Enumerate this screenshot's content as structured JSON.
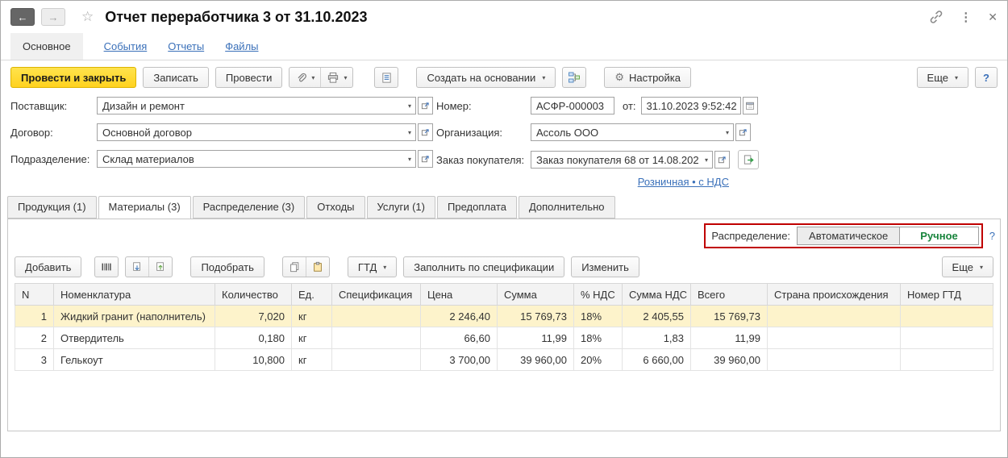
{
  "icons": {
    "back": "←",
    "forward": "→",
    "star": "☆",
    "kebab": "⋮",
    "close": "✕",
    "caret": "▾",
    "gear": "⚙"
  },
  "colors": {
    "accent_yellow": "#ffd21f",
    "link_blue": "#3a70b9",
    "annotation_red": "#c00000",
    "selected_row": "#fdf3cb",
    "manual_green": "#18843c"
  },
  "titlebar": {
    "title": "Отчет переработчика 3 от 31.10.2023"
  },
  "nav": {
    "items": [
      {
        "label": "Основное",
        "active": true
      },
      {
        "label": "События"
      },
      {
        "label": "Отчеты"
      },
      {
        "label": "Файлы"
      }
    ]
  },
  "toolbar": {
    "post_and_close": "Провести и закрыть",
    "save": "Записать",
    "post": "Провести",
    "create_on_base": "Создать на основании",
    "settings": "Настройка",
    "more": "Еще",
    "help": "?"
  },
  "form": {
    "supplier": {
      "label": "Поставщик:",
      "value": "Дизайн и ремонт"
    },
    "contract": {
      "label": "Договор:",
      "value": "Основной договор"
    },
    "department": {
      "label": "Подразделение:",
      "value": "Склад материалов"
    },
    "number": {
      "label": "Номер:",
      "value": "АСФР-000003"
    },
    "date": {
      "label": "от:",
      "value": "31.10.2023 9:52:42"
    },
    "organization": {
      "label": "Организация:",
      "value": "Ассоль ООО"
    },
    "order": {
      "label": "Заказ покупателя:",
      "value": "Заказ покупателя 68 от 14.08.202"
    },
    "price_type_link": "Розничная • с НДС"
  },
  "tabs": {
    "items": [
      {
        "label": "Продукция (1)"
      },
      {
        "label": "Материалы (3)",
        "active": true
      },
      {
        "label": "Распределение (3)"
      },
      {
        "label": "Отходы"
      },
      {
        "label": "Услуги (1)"
      },
      {
        "label": "Предоплата"
      },
      {
        "label": "Дополнительно"
      }
    ]
  },
  "distribution": {
    "label": "Распределение:",
    "options": [
      {
        "label": "Автоматическое",
        "selected": true
      },
      {
        "label": "Ручное"
      }
    ],
    "help": "?"
  },
  "table_toolbar": {
    "add": "Добавить",
    "pick": "Подобрать",
    "gtd": "ГТД",
    "fill_by_spec": "Заполнить по спецификации",
    "edit": "Изменить",
    "more": "Еще"
  },
  "table": {
    "columns": [
      "N",
      "Номенклатура",
      "Количество",
      "Ед.",
      "Спецификация",
      "Цена",
      "Сумма",
      "% НДС",
      "Сумма НДС",
      "Всего",
      "Страна происхождения",
      "Номер ГТД"
    ],
    "rows": [
      {
        "n": "1",
        "name": "Жидкий гранит (наполнитель)",
        "qty": "7,020",
        "unit": "кг",
        "spec": "",
        "price": "2 246,40",
        "sum": "15 769,73",
        "vat": "18%",
        "vat_sum": "2 405,55",
        "total": "15 769,73",
        "country": "",
        "gtd": ""
      },
      {
        "n": "2",
        "name": "Отвердитель",
        "qty": "0,180",
        "unit": "кг",
        "spec": "",
        "price": "66,60",
        "sum": "11,99",
        "vat": "18%",
        "vat_sum": "1,83",
        "total": "11,99",
        "country": "",
        "gtd": ""
      },
      {
        "n": "3",
        "name": "Гелькоут",
        "qty": "10,800",
        "unit": "кг",
        "spec": "",
        "price": "3 700,00",
        "sum": "39 960,00",
        "vat": "20%",
        "vat_sum": "6 660,00",
        "total": "39 960,00",
        "country": "",
        "gtd": ""
      }
    ]
  }
}
